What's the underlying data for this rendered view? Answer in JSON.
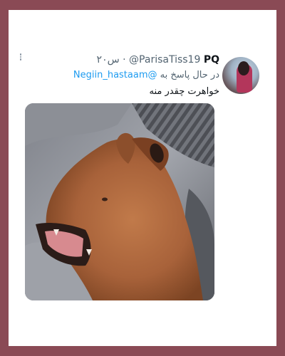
{
  "tweet": {
    "display_name": "PQ",
    "handle": "@ParisaTiss19",
    "time": "۲۰س",
    "reply_prefix": "در حال پاسخ به",
    "reply_mention": "@Negiin_hastaam",
    "text": "خواهرت چقدر منه"
  },
  "media": {
    "subject": "yawning-dog-photo"
  },
  "colors": {
    "frame": "#8a4a55",
    "card": "#ffffff",
    "link": "#1d9bf0",
    "secondary_text": "#536471",
    "primary_text": "#0f1419"
  }
}
